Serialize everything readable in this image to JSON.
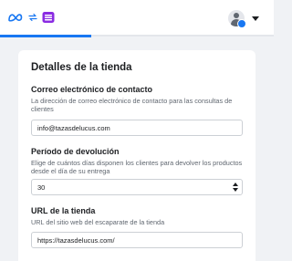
{
  "header": {
    "brand_icons": [
      "meta-icon",
      "sync-icon",
      "store-icon"
    ],
    "account": "account-avatar"
  },
  "store_details": {
    "title": "Detalles de la tienda",
    "contact_email": {
      "label": "Correo electrónico de contacto",
      "help": "La dirección de correo electrónico de contacto para las consultas de clientes",
      "value": "info@tazasdelucus.com"
    },
    "return_period": {
      "label": "Período de devolución",
      "help": "Elige de cuántos días disponen los clientes para devolver los productos desde el día de su entrega",
      "value": "30"
    },
    "store_url": {
      "label": "URL de la tienda",
      "help": "URL del sitio web del escaparate de la tienda",
      "value": "https://tazasdelucus.com/"
    }
  },
  "colors": {
    "accent": "#1877f2",
    "store_icon": "#8a2be2",
    "background": "#f0f2f5"
  }
}
